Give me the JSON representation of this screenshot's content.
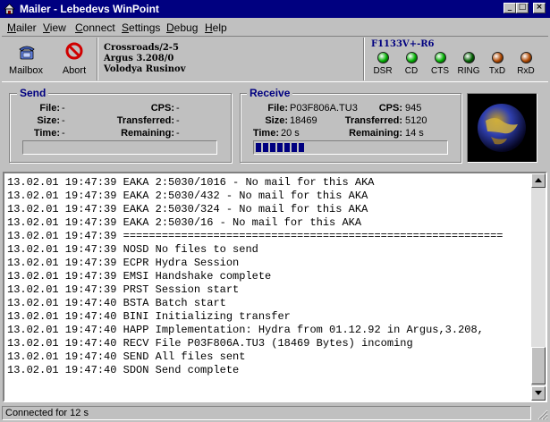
{
  "window": {
    "title": "Mailer - Lebedevs WinPoint"
  },
  "menu": [
    {
      "label": "Mailer",
      "key": "M",
      "rest": "ailer"
    },
    {
      "label": "View",
      "key": "V",
      "rest": "iew"
    },
    {
      "label": "Connect",
      "key": "C",
      "rest": "onnect"
    },
    {
      "label": "Settings",
      "key": "S",
      "rest": "ettings"
    },
    {
      "label": "Debug",
      "key": "D",
      "rest": "ebug"
    },
    {
      "label": "Help",
      "key": "H",
      "rest": "elp"
    }
  ],
  "toolbar": {
    "mailbox_label": "Mailbox",
    "abort_label": "Abort"
  },
  "session": {
    "line1": "Crossroads/2-5",
    "line2": "Argus 3.208/0",
    "line3": "Volodya Rusinov"
  },
  "modem": {
    "name": "F1133V+-R6",
    "leds": [
      {
        "label": "DSR",
        "color": "#00b000"
      },
      {
        "label": "CD",
        "color": "#00b000"
      },
      {
        "label": "CTS",
        "color": "#00b000"
      },
      {
        "label": "RING",
        "color": "#006000"
      },
      {
        "label": "TxD",
        "color": "#b04800"
      },
      {
        "label": "RxD",
        "color": "#b04800"
      }
    ]
  },
  "send": {
    "title": "Send",
    "file_label": "File:",
    "file": "-",
    "size_label": "Size:",
    "size": "-",
    "time_label": "Time:",
    "time": "-",
    "cps_label": "CPS:",
    "cps": "-",
    "transferred_label": "Transferred:",
    "transferred": "-",
    "remaining_label": "Remaining:",
    "remaining": "-",
    "progress": 0
  },
  "receive": {
    "title": "Receive",
    "file_label": "File:",
    "file": "P03F806A.TU3",
    "size_label": "Size:",
    "size": "18469",
    "time_label": "Time:",
    "time": "20 s",
    "cps_label": "CPS:",
    "cps": "945",
    "transferred_label": "Transferred:",
    "transferred": "5120",
    "remaining_label": "Remaining:",
    "remaining": "14 s",
    "progress": 0.277
  },
  "log": [
    "13.02.01 19:47:39 EAKA 2:5030/1016 - No mail for this AKA",
    "13.02.01 19:47:39 EAKA 2:5030/432 - No mail for this AKA",
    "13.02.01 19:47:39 EAKA 2:5030/324 - No mail for this AKA",
    "13.02.01 19:47:39 EAKA 2:5030/16 - No mail for this AKA",
    "13.02.01 19:47:39 ===========================================================",
    "13.02.01 19:47:39 NOSD No files to send",
    "13.02.01 19:47:39 ECPR Hydra Session",
    "13.02.01 19:47:39 EMSI Handshake complete",
    "13.02.01 19:47:39 PRST Session start",
    "13.02.01 19:47:40 BSTA Batch start",
    "13.02.01 19:47:40 BINI Initializing transfer",
    "13.02.01 19:47:40 HAPP Implementation: Hydra from 01.12.92 in Argus,3.208,",
    "13.02.01 19:47:40 RECV File P03F806A.TU3 (18469 Bytes) incoming",
    "13.02.01 19:47:40 SEND All files sent",
    "13.02.01 19:47:40 SDON Send complete"
  ],
  "status": {
    "text": "Connected for 12 s"
  }
}
